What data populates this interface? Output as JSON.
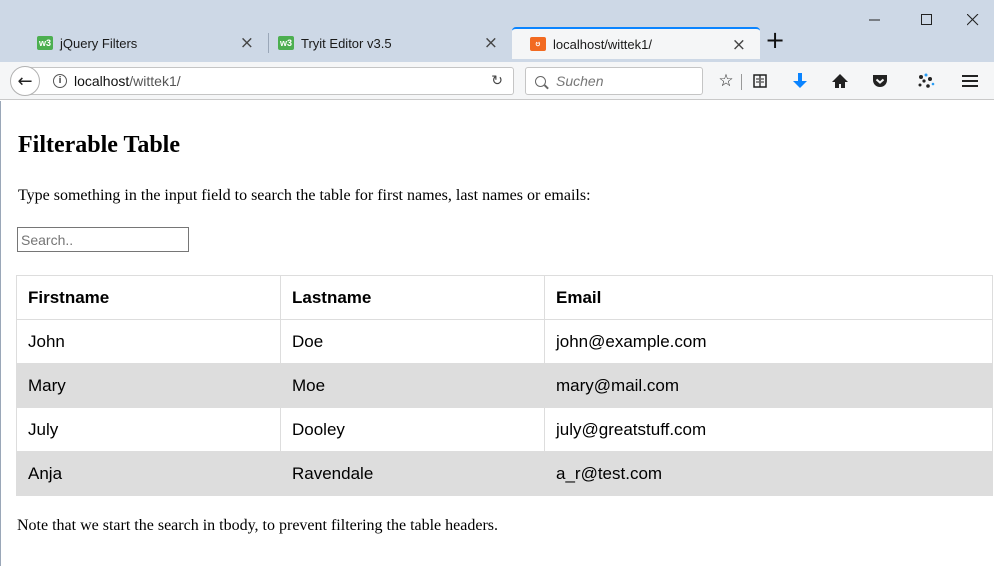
{
  "browser": {
    "tabs": [
      {
        "title": "jQuery Filters",
        "icon": "w3schools-favicon-icon",
        "active": false
      },
      {
        "title": "Tryit Editor v3.5",
        "icon": "w3schools-favicon-icon",
        "active": false
      },
      {
        "title": "localhost/wittek1/",
        "icon": "xampp-favicon-icon",
        "active": true
      }
    ],
    "tab_close_glyph": "×",
    "new_tab_glyph": "+",
    "window_controls": {
      "minimize": "—",
      "maximize": "☐",
      "close": "✕"
    },
    "accent_color": "#0a84ff",
    "nav": {
      "back_glyph": "←",
      "url_host": "localhost",
      "url_path": "/wittek1/",
      "reload_glyph": "C",
      "search_placeholder": "Suchen"
    }
  },
  "page": {
    "title": "Filterable Table",
    "intro": "Type something in the input field to search the table for first names, last names or emails:",
    "search": {
      "placeholder": "Search..",
      "value": ""
    },
    "table": {
      "headers": [
        "Firstname",
        "Lastname",
        "Email"
      ],
      "rows": [
        [
          "John",
          "Doe",
          "john@example.com"
        ],
        [
          "Mary",
          "Moe",
          "mary@mail.com"
        ],
        [
          "July",
          "Dooley",
          "july@greatstuff.com"
        ],
        [
          "Anja",
          "Ravendale",
          "a_r@test.com"
        ]
      ],
      "stripe_color": "#dddddd"
    },
    "note": "Note that we start the search in tbody, to prevent filtering the table headers."
  }
}
